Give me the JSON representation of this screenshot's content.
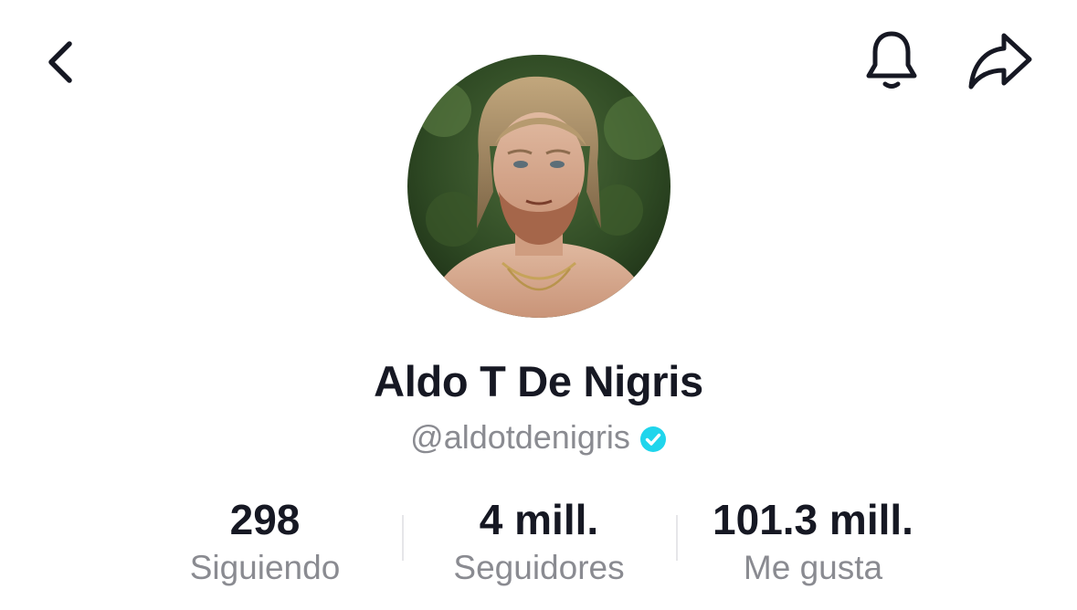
{
  "header": {
    "back_icon": "chevron-left-icon",
    "bell_icon": "bell-icon",
    "share_icon": "share-arrow-icon"
  },
  "profile": {
    "name": "Aldo T De Nigris",
    "handle": "@aldotdenigris",
    "verified": true,
    "verified_color": "#20d5ec"
  },
  "stats": [
    {
      "value": "298",
      "label": "Siguiendo"
    },
    {
      "value": "4 mill.",
      "label": "Seguidores"
    },
    {
      "value": "101.3 mill.",
      "label": "Me gusta"
    }
  ],
  "colors": {
    "primary_text": "#161823",
    "secondary_text": "#8a8b91",
    "divider": "#e6e6e9"
  }
}
